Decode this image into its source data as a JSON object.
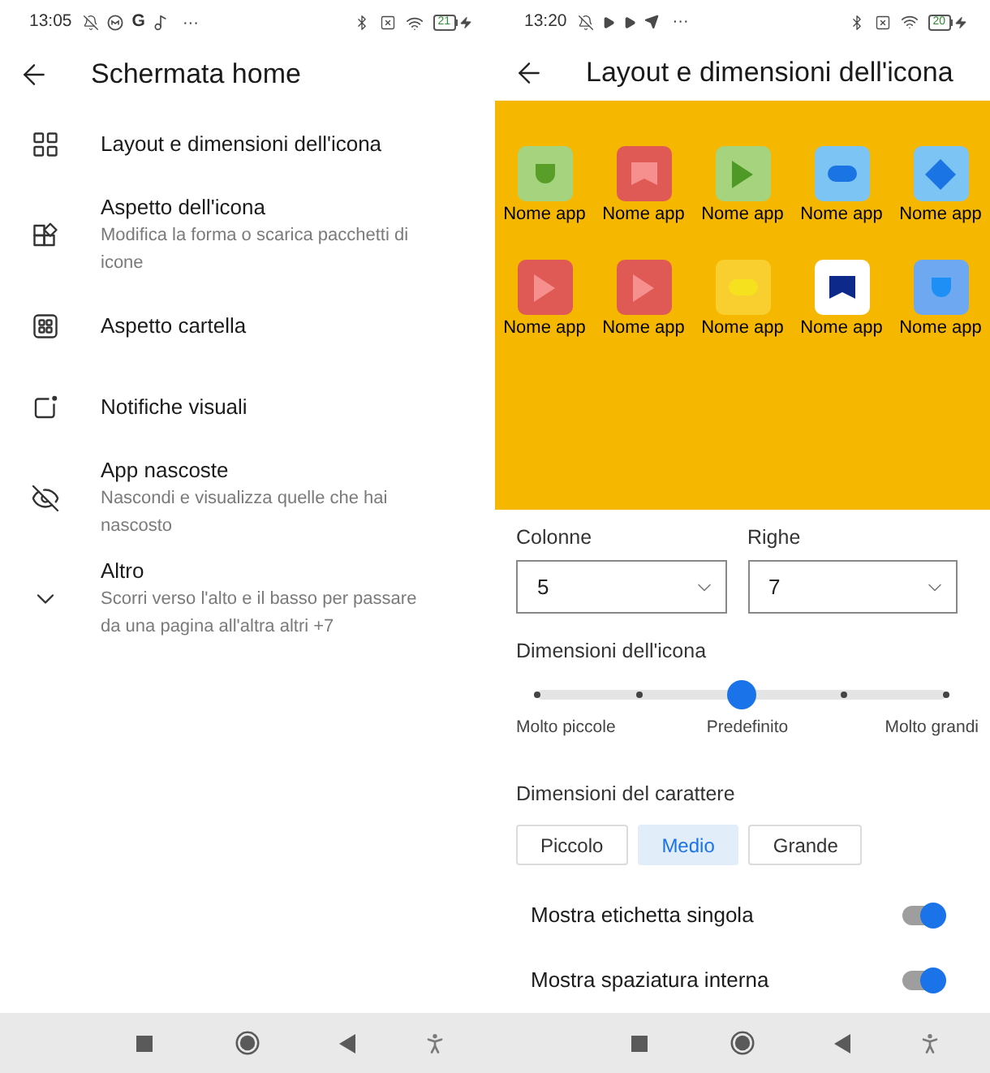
{
  "left_screen": {
    "status_bar": {
      "time": "13:05",
      "letter": "G",
      "more": "···",
      "battery": "21"
    },
    "title": "Schermata home",
    "items": [
      {
        "title": "Layout e dimensioni dell'icona"
      },
      {
        "title": "Aspetto dell'icona",
        "subtitle": "Modifica la forma o scarica pacchetti di icone"
      },
      {
        "title": "Aspetto cartella"
      },
      {
        "title": "Notifiche visuali"
      },
      {
        "title": "App nascoste",
        "subtitle": "Nascondi e visualizza quelle che hai nascosto"
      },
      {
        "title": "Altro",
        "subtitle": "Scorri verso l'alto e il basso per passare da una pagina all'altra altri +7"
      }
    ]
  },
  "right_screen": {
    "status_bar": {
      "time": "13:20",
      "more": "···",
      "battery": "20"
    },
    "title": "Layout e dimensioni dell'icona",
    "preview": {
      "apps": [
        {
          "label": "Nome app",
          "tile": {
            "color": "#a6d47e"
          },
          "symbol": {
            "kind": "shield",
            "color": "#5a9e2a"
          }
        },
        {
          "label": "Nome app",
          "tile": {
            "color": "#e05a55"
          },
          "symbol": {
            "kind": "banner",
            "color": "#f5908e"
          }
        },
        {
          "label": "Nome app",
          "tile": {
            "color": "#a6d47e"
          },
          "symbol": {
            "kind": "play",
            "color": "#4f9a26"
          }
        },
        {
          "label": "Nome app",
          "tile": {
            "color": "#7cc4f4"
          },
          "symbol": {
            "kind": "pill",
            "color": "#1b74e4"
          }
        },
        {
          "label": "Nome app",
          "tile": {
            "color": "#7cc4f4"
          },
          "symbol": {
            "kind": "diamond",
            "color": "#1b74e4"
          }
        },
        {
          "label": "Nome app",
          "tile": {
            "color": "#e05a55"
          },
          "symbol": {
            "kind": "play",
            "color": "#f5908e"
          }
        },
        {
          "label": "Nome app",
          "tile": {
            "color": "#e05a55"
          },
          "symbol": {
            "kind": "play",
            "color": "#f5908e"
          }
        },
        {
          "label": "Nome app",
          "tile": {
            "color": "#f8cf2e"
          },
          "symbol": {
            "kind": "pill",
            "color": "#f6e11f"
          }
        },
        {
          "label": "Nome app",
          "tile": {
            "color": "#ffffff"
          },
          "symbol": {
            "kind": "banner",
            "color": "#0d2a8a"
          }
        },
        {
          "label": "Nome app",
          "tile": {
            "color": "#6ea8f0"
          },
          "symbol": {
            "kind": "shield",
            "color": "#1e8ff5"
          }
        }
      ]
    },
    "columns": {
      "label": "Colonne",
      "value": "5"
    },
    "rows": {
      "label": "Righe",
      "value": "7"
    },
    "icon_size": {
      "label": "Dimensioni dell'icona",
      "level": 0.5,
      "marks": [
        "Molto piccole",
        "Predefinito",
        "Molto grandi"
      ]
    },
    "font_size": {
      "label": "Dimensioni del carattere",
      "options": [
        {
          "label": "Piccolo",
          "selected": false
        },
        {
          "label": "Medio",
          "selected": true
        },
        {
          "label": "Grande",
          "selected": false
        }
      ]
    },
    "toggles": [
      {
        "label": "Mostra etichetta singola",
        "on": true
      },
      {
        "label": "Mostra spaziatura interna",
        "on": true
      }
    ]
  }
}
